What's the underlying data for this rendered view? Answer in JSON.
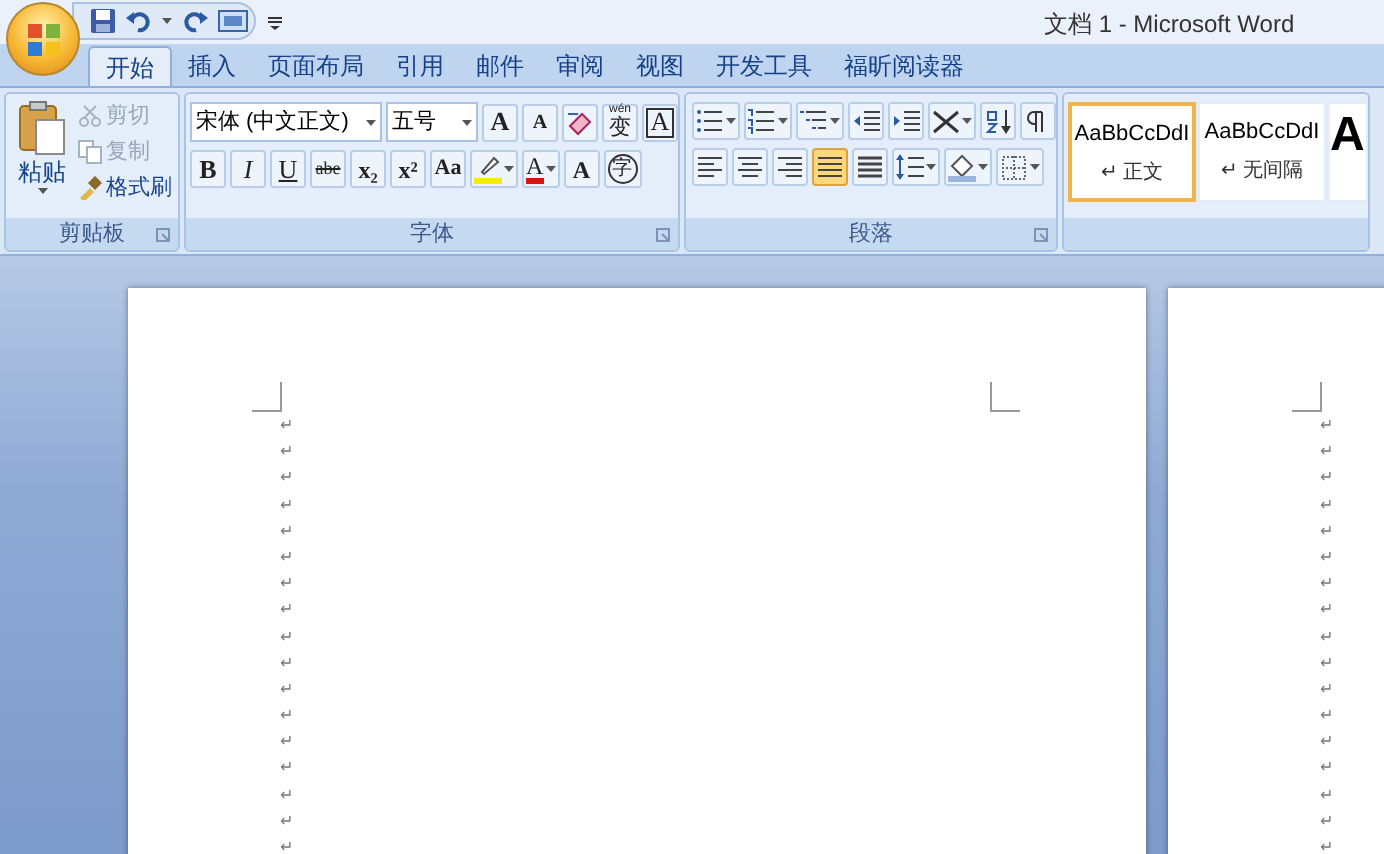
{
  "window": {
    "title": "文档 1 - Microsoft Word"
  },
  "tabs": [
    {
      "label": "开始",
      "selected": true
    },
    {
      "label": "插入",
      "selected": false
    },
    {
      "label": "页面布局",
      "selected": false
    },
    {
      "label": "引用",
      "selected": false
    },
    {
      "label": "邮件",
      "selected": false
    },
    {
      "label": "审阅",
      "selected": false
    },
    {
      "label": "视图",
      "selected": false
    },
    {
      "label": "开发工具",
      "selected": false
    },
    {
      "label": "福昕阅读器",
      "selected": false
    }
  ],
  "clipboard": {
    "label": "剪贴板",
    "paste": "粘贴",
    "items": [
      {
        "label": "剪切",
        "disabled": true,
        "kind": "cut"
      },
      {
        "label": "复制",
        "disabled": true,
        "kind": "copy"
      },
      {
        "label": "格式刷",
        "disabled": false,
        "kind": "painter"
      }
    ]
  },
  "font": {
    "label": "字体",
    "font_name": "宋体 (中文正文)",
    "font_size": "五号",
    "row1": [
      {
        "kind": "grow",
        "label": "A"
      },
      {
        "kind": "shrink",
        "label": "A"
      },
      {
        "kind": "clear"
      },
      {
        "kind": "ruby",
        "label": "变",
        "ruby": "wén"
      },
      {
        "kind": "border",
        "label": "A"
      }
    ],
    "row2": [
      {
        "kind": "bold",
        "label": "B"
      },
      {
        "kind": "italic",
        "label": "I"
      },
      {
        "kind": "underline",
        "label": "U"
      },
      {
        "kind": "strike",
        "label": "abe"
      },
      {
        "kind": "plain",
        "label": "x₂"
      },
      {
        "kind": "plain",
        "label": "x²"
      },
      {
        "kind": "case",
        "label": "Aa"
      },
      {
        "kind": "highlight"
      },
      {
        "kind": "color",
        "label": "A"
      },
      {
        "kind": "shade",
        "label": "A"
      },
      {
        "kind": "circle",
        "label": "字"
      }
    ]
  },
  "paragraph": {
    "label": "段落",
    "row1": [
      {
        "kind": "bullets"
      },
      {
        "kind": "numbering"
      },
      {
        "kind": "multilevel"
      },
      {
        "kind": "outdent"
      },
      {
        "kind": "indent"
      },
      {
        "kind": "asian"
      },
      {
        "kind": "sort"
      },
      {
        "kind": "marks"
      }
    ],
    "align": [
      {
        "kind": "left",
        "selected": false
      },
      {
        "kind": "center",
        "selected": false
      },
      {
        "kind": "right",
        "selected": false
      },
      {
        "kind": "justify",
        "selected": true
      },
      {
        "kind": "distribute",
        "selected": false
      }
    ],
    "row2": [
      {
        "kind": "spacing"
      },
      {
        "kind": "fill"
      },
      {
        "kind": "borders"
      }
    ]
  },
  "styles": [
    {
      "sample": "AaBbCcDdI",
      "name": "↵ 正文",
      "selected": true
    },
    {
      "sample": "AaBbCcDdI",
      "name": "↵ 无间隔",
      "selected": false
    },
    {
      "sample": "A",
      "selected": false
    }
  ],
  "pages": [
    {
      "marks": [
        "↵",
        "↵",
        "↵",
        "↵",
        "↵",
        "↵",
        "↵",
        "↵",
        "↵",
        "↵",
        "↵",
        "↵",
        "↵",
        "↵",
        "↵",
        "↵",
        "↵"
      ]
    },
    {
      "marks": [
        "↵",
        "↵",
        "↵",
        "↵",
        "↵",
        "↵",
        "↵",
        "↵",
        "↵",
        "↵",
        "↵",
        "↵",
        "↵",
        "↵",
        "↵",
        "↵",
        "↵"
      ]
    }
  ]
}
